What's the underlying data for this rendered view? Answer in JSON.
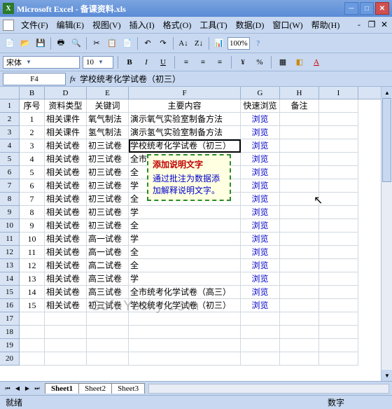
{
  "title": "Microsoft Excel - 备课资料.xls",
  "menu": [
    "文件(F)",
    "编辑(E)",
    "视图(V)",
    "插入(I)",
    "格式(O)",
    "工具(T)",
    "数据(D)",
    "窗口(W)",
    "帮助(H)"
  ],
  "zoom": "100%",
  "font": {
    "name": "宋体",
    "size": "10"
  },
  "namebox": "F4",
  "formula": "学校统考化学试卷（初三）",
  "columns": [
    "B",
    "D",
    "E",
    "F",
    "G",
    "H",
    "I"
  ],
  "headers": {
    "B": "序号",
    "D": "资料类型",
    "E": "关键词",
    "F": "主要内容",
    "G": "快速浏览",
    "H": "备注"
  },
  "rows": [
    {
      "n": 1,
      "B": "1",
      "D": "相关课件",
      "E": "氧气制法",
      "F": "演示氧气实验室制备方法",
      "G": "浏览"
    },
    {
      "n": 2,
      "B": "2",
      "D": "相关课件",
      "E": "氢气制法",
      "F": "演示氢气实验室制备方法",
      "G": "浏览"
    },
    {
      "n": 3,
      "B": "3",
      "D": "相关试卷",
      "E": "初三试卷",
      "F": "学校统考化学试卷（初三）",
      "G": "浏览"
    },
    {
      "n": 4,
      "B": "4",
      "D": "相关试卷",
      "E": "初三试卷",
      "F": "全市统考化学试卷（初三）",
      "G": "浏览"
    },
    {
      "n": 5,
      "B": "5",
      "D": "相关试卷",
      "E": "初三试卷",
      "F": "全",
      "G": "浏览"
    },
    {
      "n": 6,
      "B": "6",
      "D": "相关试卷",
      "E": "初三试卷",
      "F": "学",
      "G": "浏览"
    },
    {
      "n": 7,
      "B": "7",
      "D": "相关试卷",
      "E": "初三试卷",
      "F": "全",
      "G": "浏览"
    },
    {
      "n": 8,
      "B": "8",
      "D": "相关试卷",
      "E": "初三试卷",
      "F": "学",
      "G": "浏览"
    },
    {
      "n": 9,
      "B": "9",
      "D": "相关试卷",
      "E": "初三试卷",
      "F": "全",
      "G": "浏览"
    },
    {
      "n": 10,
      "B": "10",
      "D": "相关试卷",
      "E": "高一试卷",
      "F": "学",
      "G": "浏览"
    },
    {
      "n": 11,
      "B": "11",
      "D": "相关试卷",
      "E": "高一试卷",
      "F": "全",
      "G": "浏览"
    },
    {
      "n": 12,
      "B": "12",
      "D": "相关试卷",
      "E": "高二试卷",
      "F": "全",
      "G": "浏览"
    },
    {
      "n": 13,
      "B": "13",
      "D": "相关试卷",
      "E": "高三试卷",
      "F": "学",
      "G": "浏览"
    },
    {
      "n": 14,
      "B": "14",
      "D": "相关试卷",
      "E": "高三试卷",
      "F": "全市统考化学试卷（高三）",
      "G": "浏览"
    },
    {
      "n": 15,
      "B": "15",
      "D": "相关试卷",
      "E": "初三试卷",
      "F": "学校统考化学试卷（初三）",
      "G": "浏览"
    },
    {
      "n": 16
    },
    {
      "n": 17
    },
    {
      "n": 18
    },
    {
      "n": 19
    }
  ],
  "comment": {
    "title": "添加说明文字",
    "body": "通过批注为数据添加解释说明文字。"
  },
  "sheets": [
    "Sheet1",
    "Sheet2",
    "Sheet3"
  ],
  "status": {
    "left": "就绪",
    "right": "数字"
  },
  "watermark": "Soft.Yesky.c⊙m"
}
